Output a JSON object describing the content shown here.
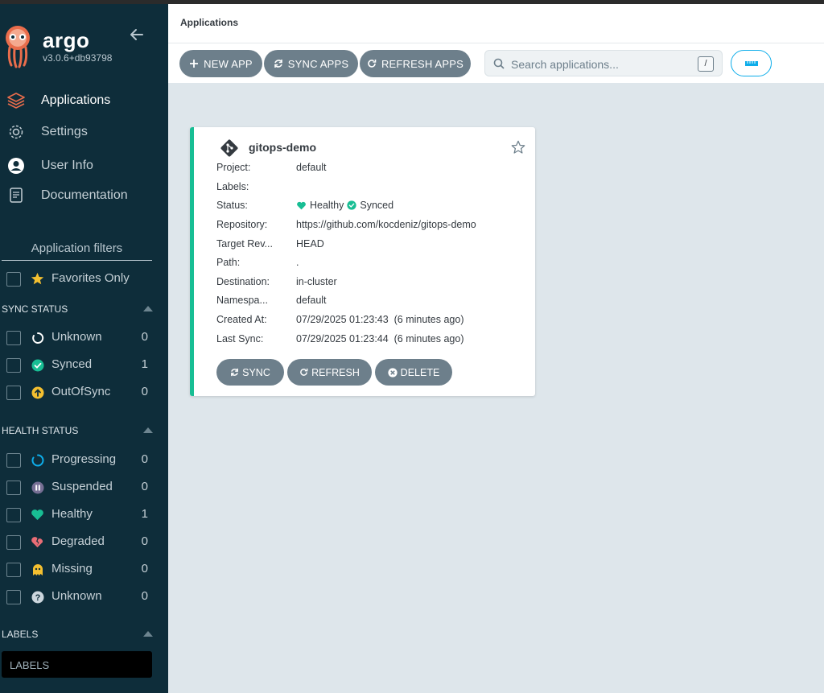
{
  "app": {
    "brand": "argo",
    "version": "v3.0.6+db93798"
  },
  "nav": [
    {
      "label": "Applications",
      "icon": "layers-icon",
      "active": true
    },
    {
      "label": "Settings",
      "icon": "gear-icon"
    },
    {
      "label": "User Info",
      "icon": "user-icon"
    },
    {
      "label": "Documentation",
      "icon": "book-icon"
    }
  ],
  "filters": {
    "title": "Application filters",
    "favorites": "Favorites Only",
    "sync_status": {
      "heading": "SYNC STATUS",
      "items": [
        {
          "label": "Unknown",
          "count": "0",
          "icon": "circle-notch-icon",
          "color": "#ffffff"
        },
        {
          "label": "Synced",
          "count": "1",
          "icon": "check-circle-icon",
          "color": "#18be94"
        },
        {
          "label": "OutOfSync",
          "count": "0",
          "icon": "arrow-up-circle-icon",
          "color": "#f4c030"
        }
      ]
    },
    "health_status": {
      "heading": "HEALTH STATUS",
      "items": [
        {
          "label": "Progressing",
          "count": "0",
          "icon": "spinner-icon",
          "color": "#0dadea"
        },
        {
          "label": "Suspended",
          "count": "0",
          "icon": "pause-circle-icon",
          "color": "#766f94"
        },
        {
          "label": "Healthy",
          "count": "1",
          "icon": "heart-icon",
          "color": "#18be94"
        },
        {
          "label": "Degraded",
          "count": "0",
          "icon": "heart-broken-icon",
          "color": "#e96d76"
        },
        {
          "label": "Missing",
          "count": "0",
          "icon": "ghost-icon",
          "color": "#f4c030"
        },
        {
          "label": "Unknown",
          "count": "0",
          "icon": "question-circle-icon",
          "color": "#ccd6dd"
        }
      ]
    },
    "labels": {
      "heading": "LABELS",
      "placeholder": "LABELS"
    }
  },
  "header": {
    "breadcrumb": "Applications"
  },
  "toolbar": {
    "new_app": "NEW APP",
    "sync_apps": "SYNC APPS",
    "refresh_apps": "REFRESH APPS",
    "search_placeholder": "Search applications...",
    "search_shortcut": "/"
  },
  "app_card": {
    "name": "gitops-demo",
    "fields": [
      {
        "label": "Project:",
        "value": "default"
      },
      {
        "label": "Labels:",
        "value": ""
      },
      {
        "label": "Status:",
        "value": ""
      },
      {
        "label": "Repository:",
        "value": "https://github.com/kocdeniz/gitops-demo"
      },
      {
        "label": "Target Rev...",
        "value": "HEAD"
      },
      {
        "label": "Path:",
        "value": "."
      },
      {
        "label": "Destination:",
        "value": "in-cluster"
      },
      {
        "label": "Namespa...",
        "value": "default"
      },
      {
        "label": "Created At:",
        "value": "07/29/2025 01:23:43  (6 minutes ago)"
      },
      {
        "label": "Last Sync:",
        "value": "07/29/2025 01:23:44  (6 minutes ago)"
      }
    ],
    "health": "Healthy",
    "sync": "Synced",
    "actions": {
      "sync": "SYNC",
      "refresh": "REFRESH",
      "delete": "DELETE"
    }
  },
  "colors": {
    "sidebar": "#0e2d3a",
    "accent": "#18be94",
    "button": "#6d7f8b",
    "link": "#0dadea"
  }
}
